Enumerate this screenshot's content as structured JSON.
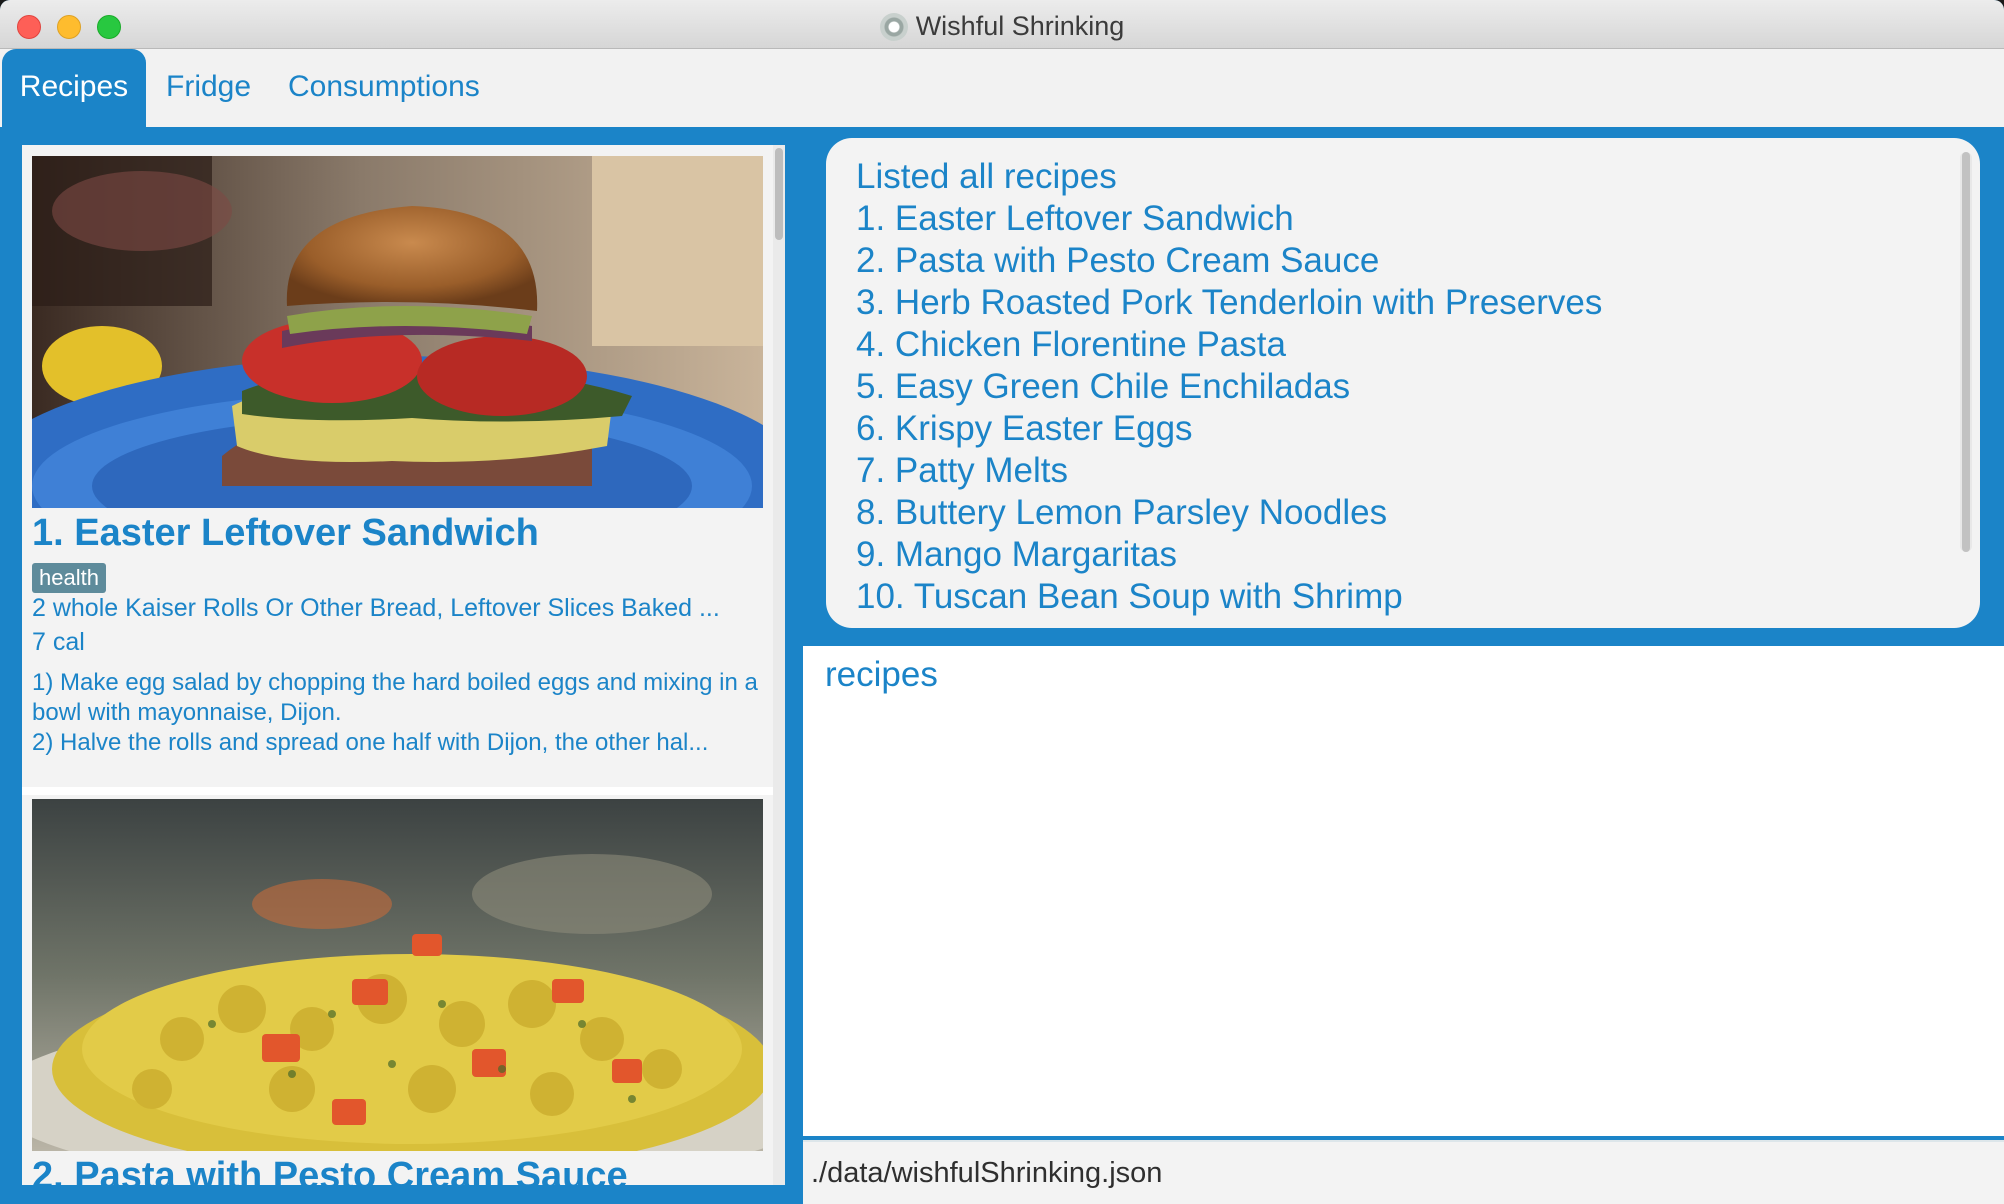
{
  "window": {
    "title": "Wishful Shrinking"
  },
  "tabs": [
    {
      "label": "Recipes",
      "active": true
    },
    {
      "label": "Fridge",
      "active": false
    },
    {
      "label": "Consumptions",
      "active": false
    }
  ],
  "recipes": [
    {
      "title": "1.  Easter Leftover Sandwich",
      "tag": "health",
      "ingredients": "2 whole Kaiser Rolls Or Other Bread, Leftover Slices Baked ...",
      "calories": "7 cal",
      "step1": "1) Make egg salad by chopping the hard boiled eggs and mixing in a bowl with mayonnaise, Dijon.",
      "step2": "2) Halve the rolls and spread one half with Dijon, the other hal..."
    },
    {
      "title": "2.  Pasta with Pesto Cream Sauce"
    }
  ],
  "result": {
    "header": "Listed all recipes",
    "items": [
      "1. Easter Leftover Sandwich",
      "2. Pasta with Pesto Cream Sauce",
      "3. Herb Roasted Pork Tenderloin with Preserves",
      "4. Chicken Florentine Pasta",
      "5. Easy Green Chile Enchiladas",
      "6. Krispy Easter Eggs",
      "7. Patty Melts",
      "8. Buttery Lemon Parsley Noodles",
      "9. Mango Margaritas",
      "10. Tuscan Bean Soup with Shrimp"
    ]
  },
  "command": {
    "value": "recipes"
  },
  "status": {
    "path": "./data/wishfulShrinking.json"
  },
  "colors": {
    "accent": "#1b84c8",
    "panel": "#f3f3f3",
    "tag": "#5e8b9b"
  }
}
